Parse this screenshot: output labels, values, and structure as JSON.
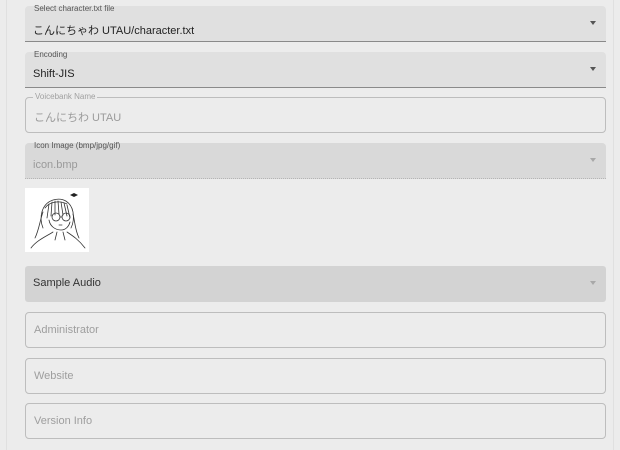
{
  "character_file": {
    "label": "Select character.txt file",
    "value": "こんにちゃわ UTAU/character.txt"
  },
  "encoding": {
    "label": "Encoding",
    "value": "Shift-JIS"
  },
  "voicebank_name": {
    "label": "Voicebank Name",
    "value": "こんにちわ UTAU"
  },
  "icon_image": {
    "label": "Icon Image (bmp/jpg/gif)",
    "value": "icon.bmp",
    "preview_icon": "anime-girl-sketch-icon"
  },
  "sample_audio": {
    "placeholder": "Sample Audio"
  },
  "administrator": {
    "placeholder": "Administrator"
  },
  "website": {
    "placeholder": "Website"
  },
  "version_info": {
    "placeholder": "Version Info"
  }
}
